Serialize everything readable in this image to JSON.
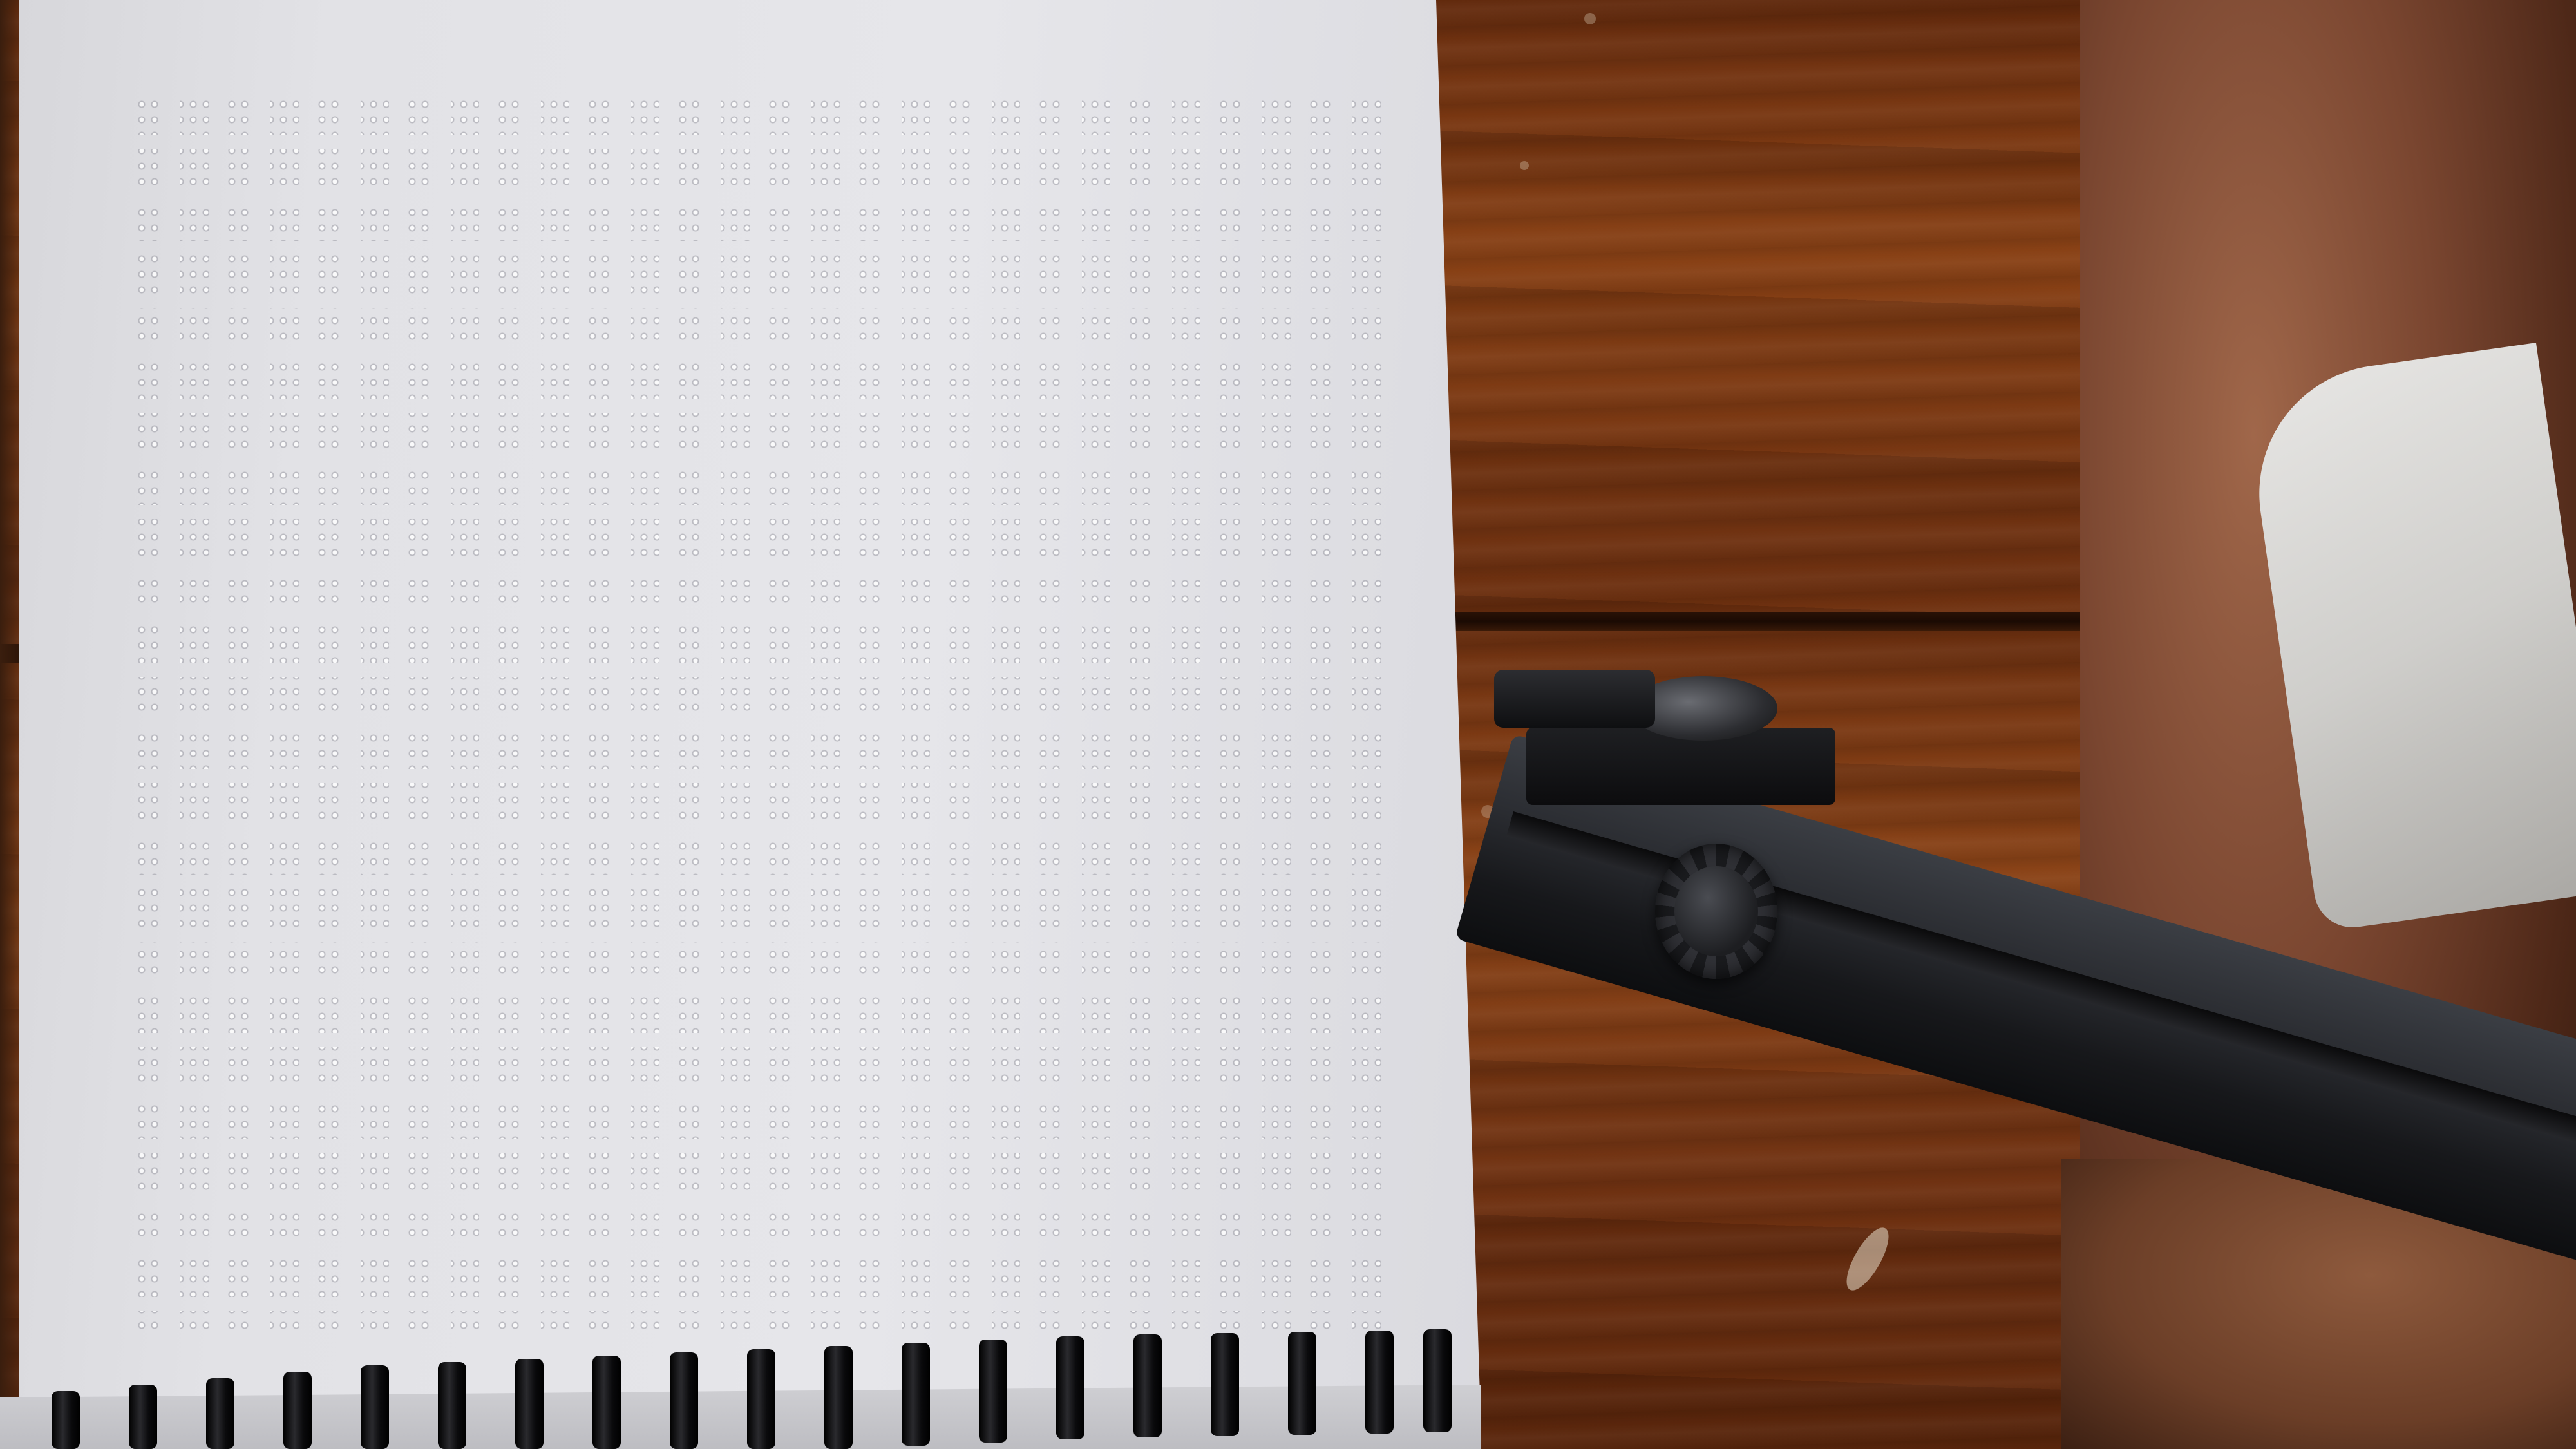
{
  "scene": {
    "subject": "braille-page",
    "colors": {
      "table": "#7a3a14",
      "page": "#e4e4e8",
      "stand": "#1e1f23"
    }
  }
}
